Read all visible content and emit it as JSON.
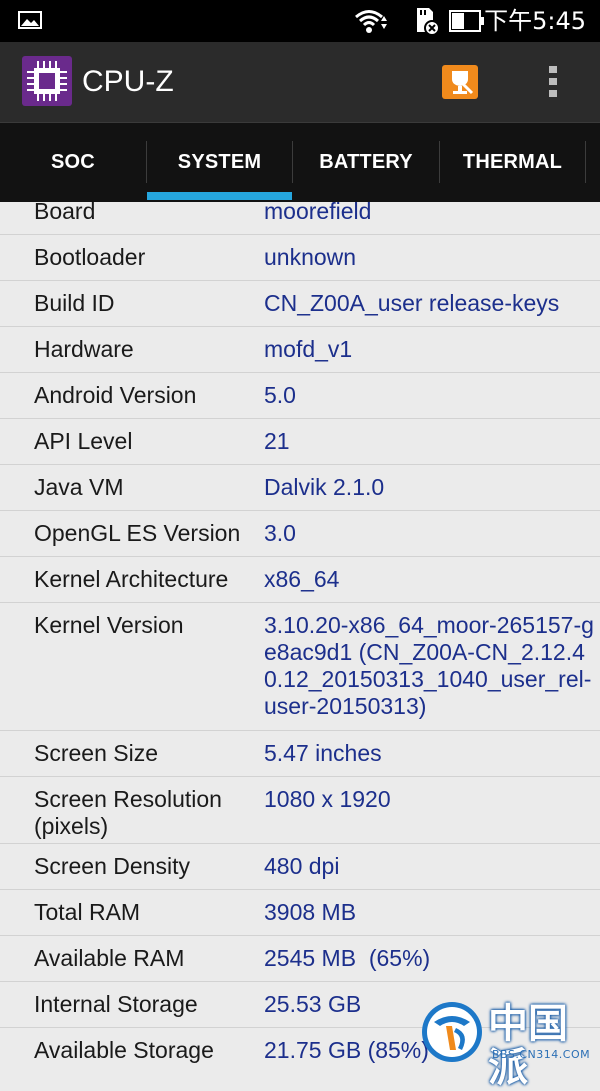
{
  "status_bar": {
    "time": "下午5:45",
    "icons": [
      "gallery-icon",
      "wifi-icon",
      "sd-card-icon",
      "battery-icon"
    ]
  },
  "app_bar": {
    "title": "CPU-Z",
    "icons": [
      "cpu-chip-icon",
      "benchmark-icon",
      "overflow-menu-icon"
    ],
    "accent_color": "#f08a1c"
  },
  "tabs": [
    {
      "label": "SOC",
      "active": false
    },
    {
      "label": "SYSTEM",
      "active": true
    },
    {
      "label": "BATTERY",
      "active": false
    },
    {
      "label": "THERMAL",
      "active": false
    }
  ],
  "tab_indicator_color": "#25a6de",
  "system_info": [
    {
      "label": "Board",
      "value": "moorefield"
    },
    {
      "label": "Bootloader",
      "value": "unknown"
    },
    {
      "label": "Build ID",
      "value": "CN_Z00A_user release-keys"
    },
    {
      "label": "Hardware",
      "value": "mofd_v1"
    },
    {
      "label": "Android Version",
      "value": "5.0"
    },
    {
      "label": "API Level",
      "value": "21"
    },
    {
      "label": "Java VM",
      "value": "Dalvik 2.1.0"
    },
    {
      "label": "OpenGL ES Version",
      "value": "3.0"
    },
    {
      "label": "Kernel Architecture",
      "value": "x86_64"
    },
    {
      "label": "Kernel Version",
      "value": "3.10.20-x86_64_moor-265157-ge8ac9d1 (CN_Z00A-CN_2.12.40.12_20150313_1040_user_rel-user-20150313)"
    },
    {
      "label": "Screen Size",
      "value": "5.47 inches"
    },
    {
      "label": "Screen Resolution (pixels)",
      "value": "1080 x 1920"
    },
    {
      "label": "Screen Density",
      "value": "480 dpi"
    },
    {
      "label": "Total RAM",
      "value": "3908 MB"
    },
    {
      "label": "Available RAM",
      "value": "2545 MB  (65%)"
    },
    {
      "label": "Internal Storage",
      "value": "25.53 GB"
    },
    {
      "label": "Available Storage",
      "value": "21.75 GB (85%)"
    }
  ],
  "colors": {
    "label_text": "#1a1a1a",
    "value_text": "#1c2f8c",
    "background": "#ebebeb"
  },
  "watermark": {
    "text": "中国派",
    "url": "BBS.CN314.COM"
  }
}
